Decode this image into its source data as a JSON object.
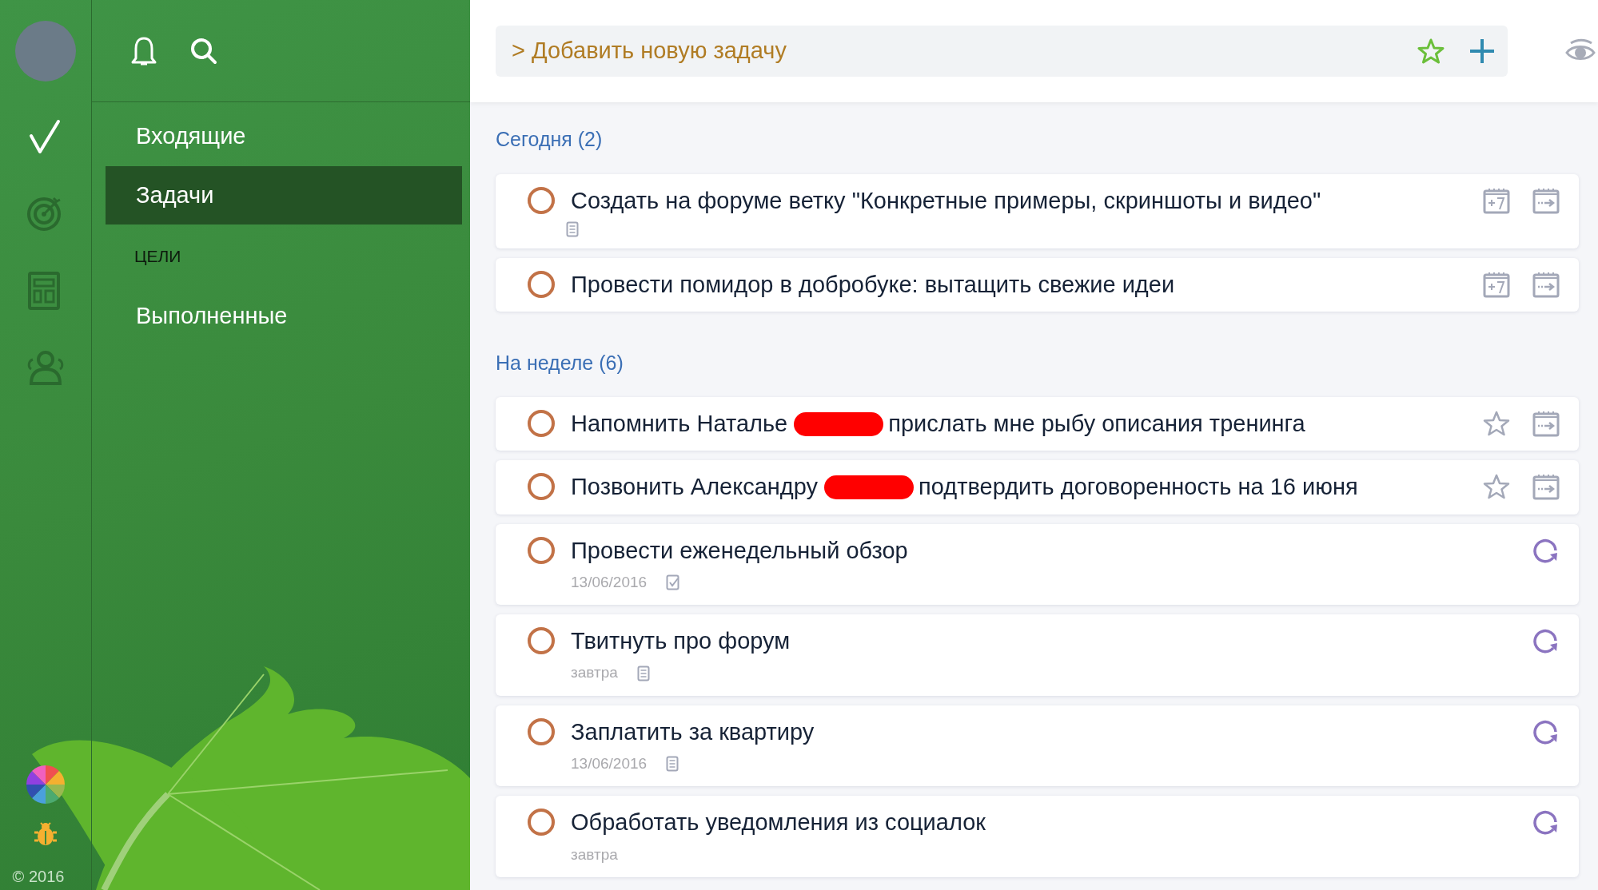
{
  "rail": {
    "items": [
      {
        "kind": "tasks",
        "selected": true
      },
      {
        "kind": "goals",
        "selected": false
      },
      {
        "kind": "board",
        "selected": false
      },
      {
        "kind": "people",
        "selected": false
      }
    ],
    "copyright": "© 2016"
  },
  "nav": {
    "items": [
      {
        "kind": "link",
        "label": "Входящие",
        "selected": false
      },
      {
        "kind": "link",
        "label": "Задачи",
        "selected": true
      },
      {
        "kind": "heading",
        "label": "ЦЕЛИ",
        "selected": false
      },
      {
        "kind": "link",
        "label": "Выполненные",
        "selected": false
      }
    ]
  },
  "add_task": {
    "placeholder": "> Добавить новую задачу"
  },
  "sections": [
    {
      "title": "Сегодня (2)",
      "tasks": [
        {
          "kind": "postpone",
          "checked": false,
          "title_parts": [
            "Создать на форуме ветку \"Конкретные примеры, скриншоты и видео\""
          ],
          "redacted": false,
          "has_note": true
        },
        {
          "kind": "postpone",
          "checked": false,
          "title_parts": [
            "Провести помидор в добробуке: вытащить свежие идеи"
          ],
          "redacted": false
        }
      ]
    },
    {
      "title": "На неделе (6)",
      "tasks": [
        {
          "kind": "star",
          "checked": false,
          "title_parts": [
            "Напомнить Наталье",
            "прислать мне рыбу описания тренинга"
          ],
          "redacted": true
        },
        {
          "kind": "star",
          "checked": false,
          "title_parts": [
            "Позвонить Александру",
            "подтвердить договоренность на 16 июня"
          ],
          "redacted": true
        },
        {
          "kind": "repeat",
          "checked": false,
          "title_parts": [
            "Провести еженедельный обзор"
          ],
          "redacted": false,
          "date": "13/06/2016",
          "has_checklist": true
        },
        {
          "kind": "repeat",
          "checked": false,
          "title_parts": [
            "Твитнуть про форум"
          ],
          "redacted": false,
          "date": "завтра",
          "has_note": true
        },
        {
          "kind": "repeat",
          "checked": false,
          "title_parts": [
            "Заплатить за квартиру"
          ],
          "redacted": false,
          "date": "13/06/2016",
          "has_note": true
        },
        {
          "kind": "repeat",
          "checked": false,
          "title_parts": [
            "Обработать уведомления из социалок"
          ],
          "redacted": false,
          "date": "завтра"
        }
      ]
    }
  ]
}
